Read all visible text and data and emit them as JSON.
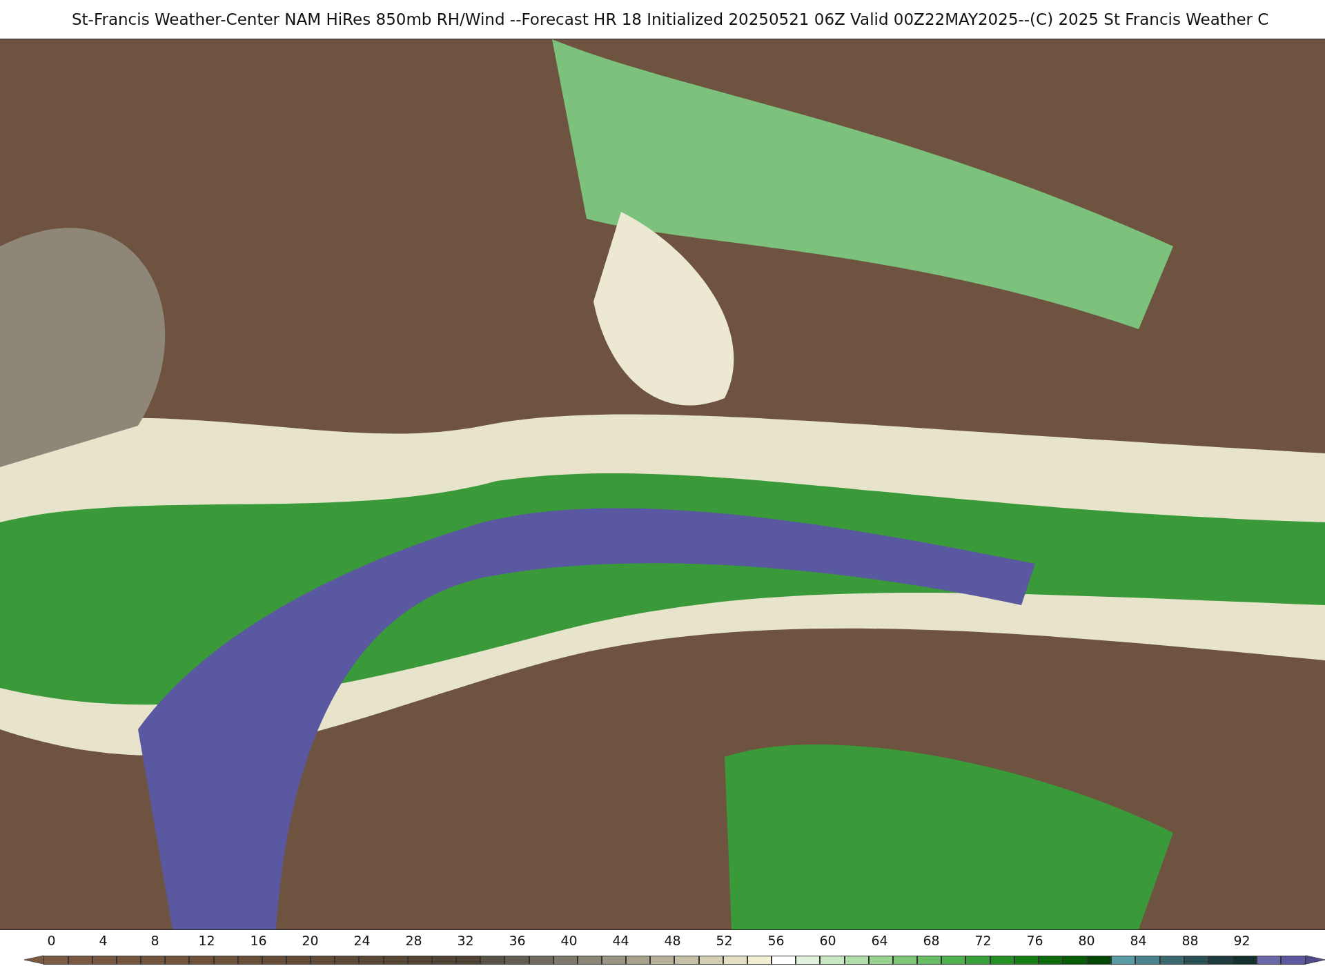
{
  "title": "St-Francis Weather-Center NAM HiRes 850mb RH/Wind  --Forecast HR 18 Initialized 20250521 06Z Valid 00Z22MAY2025--(C) 2025 St Francis Weather C",
  "colorbar": {
    "ticks": [
      "0",
      "4",
      "8",
      "12",
      "16",
      "20",
      "24",
      "28",
      "32",
      "36",
      "40",
      "44",
      "48",
      "52",
      "56",
      "60",
      "64",
      "68",
      "72",
      "76",
      "80",
      "84",
      "88",
      "92"
    ],
    "bins": [
      {
        "kind": "under",
        "color": "#7d5a42"
      },
      {
        "color": "#7d5a42"
      },
      {
        "color": "#7b5840"
      },
      {
        "color": "#79573f"
      },
      {
        "color": "#77563e"
      },
      {
        "color": "#75553d"
      },
      {
        "color": "#73543c"
      },
      {
        "color": "#71533b"
      },
      {
        "color": "#6e523a"
      },
      {
        "color": "#6b5039"
      },
      {
        "color": "#684e38"
      },
      {
        "color": "#654c37"
      },
      {
        "color": "#624b37"
      },
      {
        "color": "#5f4a37"
      },
      {
        "color": "#5b4836"
      },
      {
        "color": "#584635"
      },
      {
        "color": "#554535"
      },
      {
        "color": "#524434"
      },
      {
        "color": "#504334"
      },
      {
        "color": "#5a5448"
      },
      {
        "color": "#645e52"
      },
      {
        "color": "#716b5f"
      },
      {
        "color": "#7f796b"
      },
      {
        "color": "#8c8677"
      },
      {
        "color": "#9a9482"
      },
      {
        "color": "#a8a28d"
      },
      {
        "color": "#b6b198"
      },
      {
        "color": "#c5c0a5"
      },
      {
        "color": "#d4cfb3"
      },
      {
        "color": "#e4dfc2"
      },
      {
        "color": "#f2eed2"
      },
      {
        "color": "#ffffff"
      },
      {
        "color": "#e0f2dc"
      },
      {
        "color": "#c8e8c4"
      },
      {
        "color": "#b0dea8"
      },
      {
        "color": "#98d490"
      },
      {
        "color": "#80c878"
      },
      {
        "color": "#68bc64"
      },
      {
        "color": "#4fb04e"
      },
      {
        "color": "#38a038"
      },
      {
        "color": "#249024"
      },
      {
        "color": "#168016"
      },
      {
        "color": "#0c6c0c"
      },
      {
        "color": "#055c05"
      },
      {
        "color": "#024802"
      },
      {
        "color": "#5a9ca6"
      },
      {
        "color": "#4a8290"
      },
      {
        "color": "#3a6a70"
      },
      {
        "color": "#2a5256"
      },
      {
        "color": "#1e3c40"
      },
      {
        "color": "#14302e"
      },
      {
        "color": "#6a68a8"
      },
      {
        "color": "#5e58a0"
      },
      {
        "kind": "over",
        "color": "#4e4a8c"
      }
    ]
  }
}
